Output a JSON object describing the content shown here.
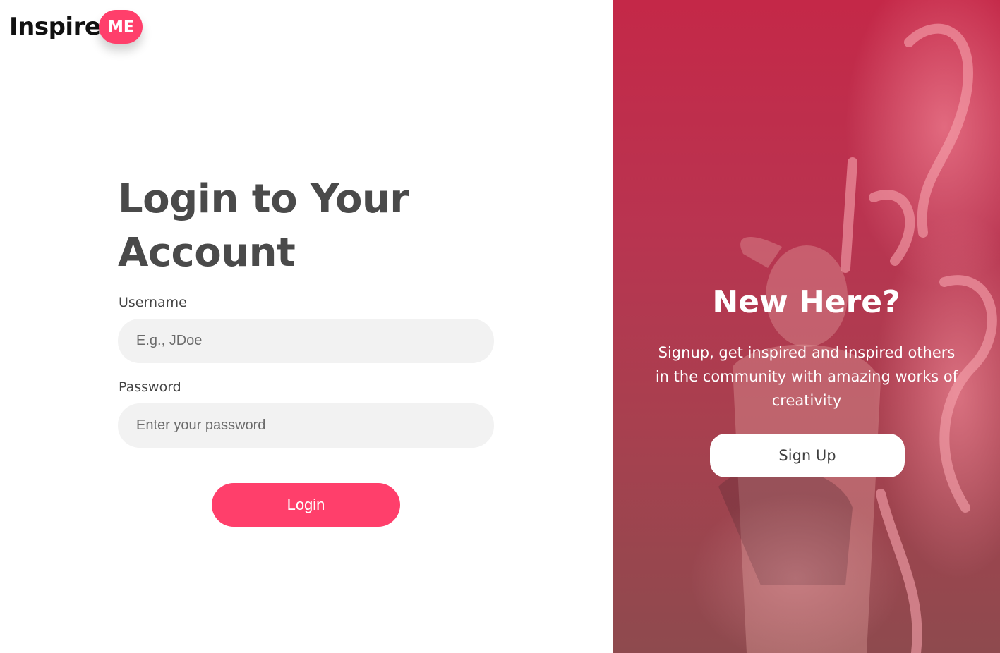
{
  "brand": {
    "name": "Inspire",
    "badge": "ME",
    "accent_color": "#ff3f6b"
  },
  "login": {
    "heading": "Login to Your Account",
    "username_label": "Username",
    "username_placeholder": "E.g., JDoe",
    "password_label": "Password",
    "password_placeholder": "Enter your password",
    "submit_label": "Login"
  },
  "signup": {
    "heading": "New Here?",
    "description": "Signup, get inspired and inspired others in the community with amazing works of creativity",
    "button_label": "Sign Up"
  }
}
